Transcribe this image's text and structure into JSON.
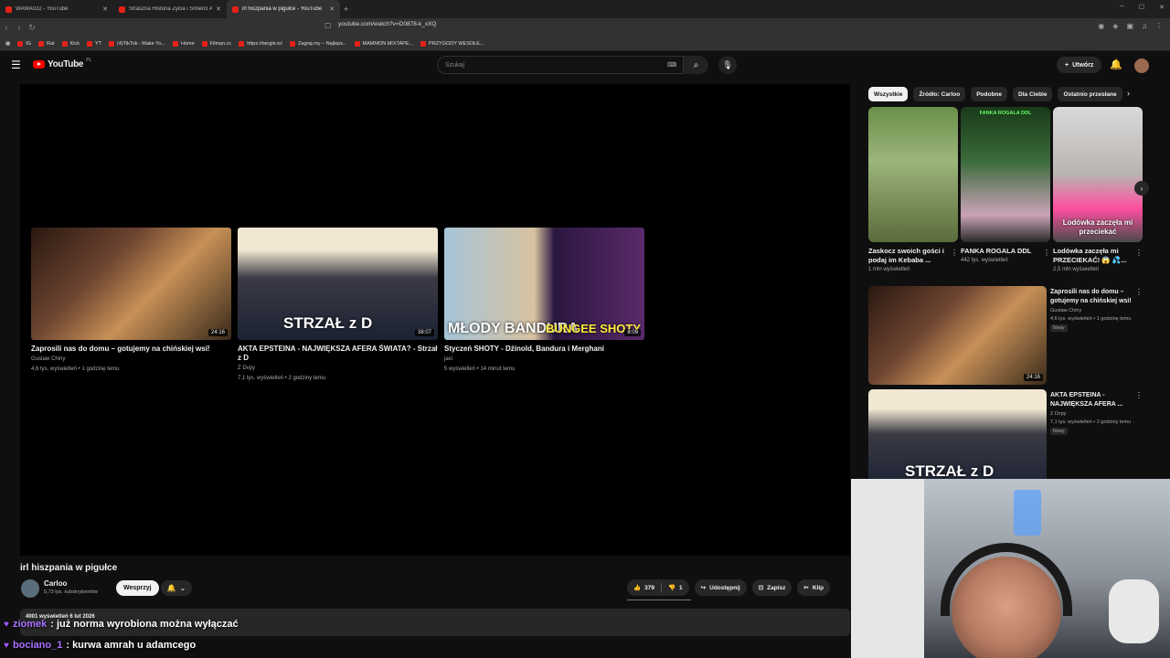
{
  "browser": {
    "tabs": [
      {
        "title": "WAWA022 - YouTube",
        "active": false
      },
      {
        "title": "Straszna Historia Życia i Śmierci Alek...",
        "active": false
      },
      {
        "title": "irl hiszpania w pigułce - YouTube",
        "active": true
      }
    ],
    "url": "youtube.com/watch?v=D0878-k_xXQ",
    "bookmarks": [
      "IG",
      "Rat",
      "Kick",
      "YT",
      "(4)TikTok - Make Yo...",
      "Home",
      "Filman.cc",
      "https://tangle.io/",
      "Zagraj.my – Najleps...",
      "MAMMON MIXTAPE...",
      "PRZYGODY WESOŁE..."
    ]
  },
  "youtube": {
    "logo_text": "YouTube",
    "country_code": "PL",
    "search_placeholder": "Szukaj",
    "create_label": "Utwórz"
  },
  "endcards": [
    {
      "title": "Zaprosili nas do domu – gotujemy na chińskiej wsi!",
      "channel": "Gustaw Chiny",
      "meta": "4,6 tys. wyświetleń • 1 godzinę temu",
      "duration": "24:16",
      "overlay": ""
    },
    {
      "title": "AKTA EPSTEINA - NAJWIĘKSZA AFERA ŚWIATA? - Strzał z D",
      "channel": "Z Dvpy",
      "meta": "7,1 tys. wyświetleń • 2 godziny temu",
      "duration": "38:07",
      "overlay": "STRZAŁ z D"
    },
    {
      "title": "Styczeń SHOTY - Dżinold, Bandura i Merghani",
      "channel": "jaxi",
      "meta": "5 wyświetleń • 14 minut temu",
      "duration": "8:09",
      "overlay": "MŁODY BANDURA"
    }
  ],
  "endcard3_overlay2": "BUNGEE SHOTY",
  "video": {
    "title": "irl hiszpania w pigułce",
    "channel": "Carloo",
    "subscribers": "5,73 tys. subskrybentów",
    "support_label": "Wesprzyj",
    "likes": "379",
    "dislikes": "1",
    "share_label": "Udostępnij",
    "save_label": "Zapisz",
    "clip_label": "Klip",
    "views_date": "4001 wyświetleń  6 lut 2026"
  },
  "chat": [
    {
      "user": "ziomek",
      "text": ": już norma wyrobiona można wyłączać"
    },
    {
      "user": "bociano_1",
      "text": ": kurwa amrah u adamcego"
    }
  ],
  "sidebar": {
    "chips": [
      "Wszystkie",
      "Źródło: Carloo",
      "Podobne",
      "Dla Ciebie",
      "Ostatnio przesłane"
    ],
    "shorts": [
      {
        "title": "Zaskocz swoich gości i podaj im Kebaba ...",
        "views": "1 mln wyświetleń",
        "overlay": "",
        "label": ""
      },
      {
        "title": "FANKA ROGALA DDL",
        "views": "442 tys. wyświetleń",
        "overlay": "",
        "label": "FANKA ROGALA DDL"
      },
      {
        "title": "Lodówka zaczęła mi PRZECIEKAĆ! 😱 💦...",
        "views": "2,5 mln wyświetleń",
        "overlay": "Lodówka zaczęła mi przeciekać",
        "label": ""
      }
    ],
    "recommended": [
      {
        "title": "Zaprosili nas do domu – gotujemy na chińskiej wsi!",
        "channel": "Gustaw Chiny",
        "meta": "4,6 tys. wyświetleń • 1 godzinę temu",
        "badge": "Nowy",
        "duration": "24:16"
      },
      {
        "title": "AKTA EPSTEINA - NAJWIĘKSZA AFERA ...",
        "channel": "Z Dvpy",
        "meta": "7,1 tys. wyświetleń • 2 godziny temu",
        "badge": "Nowy",
        "duration": ""
      }
    ]
  }
}
